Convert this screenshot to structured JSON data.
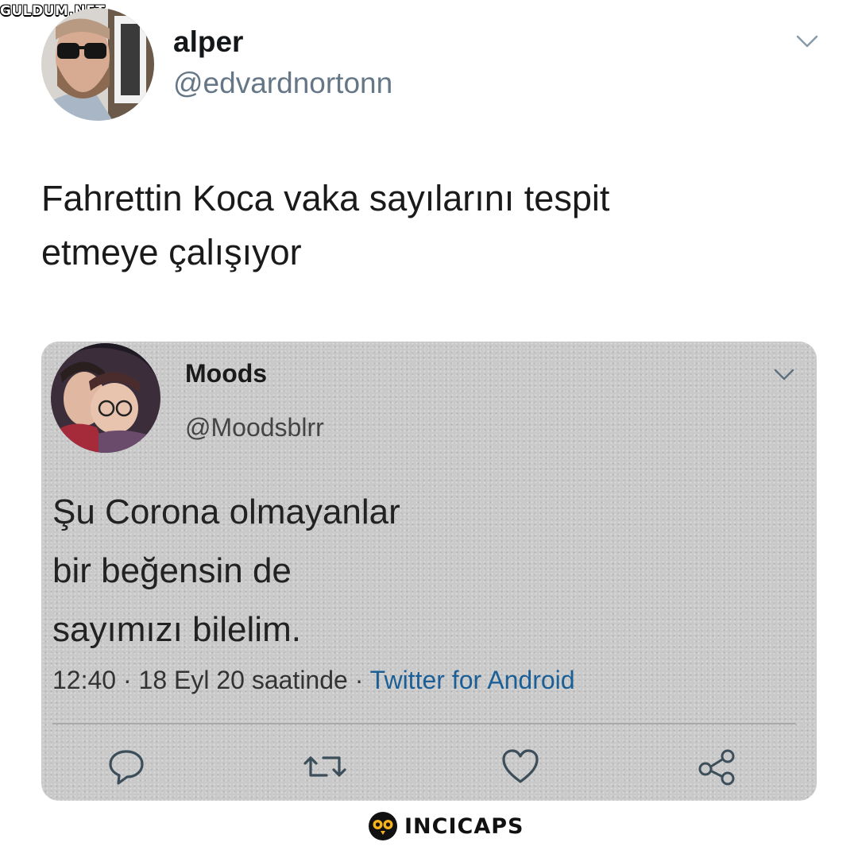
{
  "watermark": "GULDUM.NET",
  "tweet": {
    "display_name": "alper",
    "handle": "@edvardnortonn",
    "text_lines": [
      "Fahrettin Koca vaka sayılarını tespit",
      "etmeye çalışıyor"
    ]
  },
  "quoted": {
    "display_name": "Moods",
    "handle": "@Moodsblrr",
    "text_lines": [
      "Şu Corona olmayanlar",
      "bir beğensin de",
      "sayımızı bilelim."
    ],
    "time": "12:40",
    "date": "18 Eyl 20 saatinde",
    "separator": " · ",
    "source": "Twitter for Android"
  },
  "icons": {
    "reply": "reply-icon",
    "retweet": "retweet-icon",
    "like": "heart-icon",
    "share": "share-icon",
    "chevron": "chevron-down-icon",
    "logo": "owl-logo-icon"
  },
  "brand": "INCICAPS"
}
